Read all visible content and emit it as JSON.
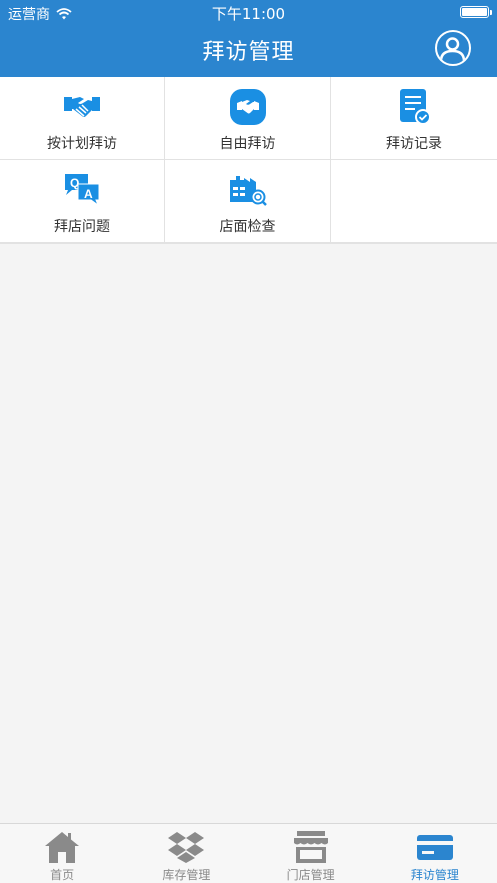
{
  "status_bar": {
    "carrier": "运营商",
    "time": "下午11:00"
  },
  "navbar": {
    "title": "拜访管理",
    "user_icon": "user-circle-icon"
  },
  "menu": [
    {
      "label": "按计划拜访",
      "icon": "handshake-icon"
    },
    {
      "label": "自由拜访",
      "icon": "handshake-badge-icon"
    },
    {
      "label": "拜访记录",
      "icon": "record-document-icon"
    },
    {
      "label": "拜店问题",
      "icon": "qa-chat-icon"
    },
    {
      "label": "店面检查",
      "icon": "store-inspect-icon"
    }
  ],
  "tabbar": {
    "active": "拜访管理",
    "items": [
      {
        "label": "首页",
        "icon": "home-icon"
      },
      {
        "label": "库存管理",
        "icon": "dropbox-boxes-icon"
      },
      {
        "label": "门店管理",
        "icon": "storefront-icon"
      },
      {
        "label": "拜访管理",
        "icon": "card-icon"
      }
    ]
  },
  "colors": {
    "primary": "#2b85cf",
    "icon_blue": "#1a8fe3",
    "inactive": "#8a8a8a",
    "background": "#f4f4f4"
  }
}
